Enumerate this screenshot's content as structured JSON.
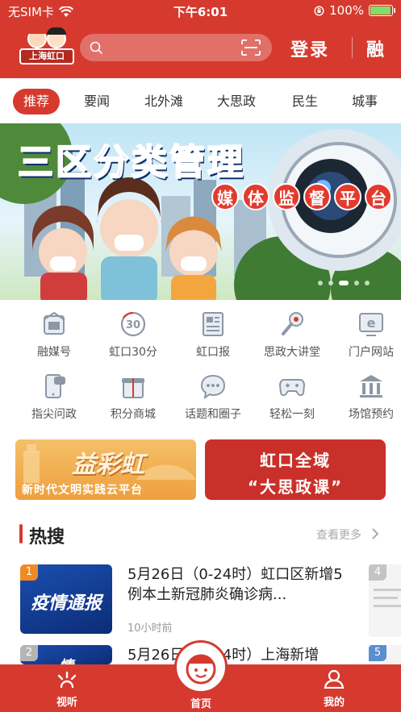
{
  "status_bar": {
    "carrier": "无SIM卡",
    "time": "下午6:01",
    "battery": "100%",
    "battery_level": 1.0
  },
  "header": {
    "logo_text": "上海虹口",
    "search_placeholder": "",
    "login_label": "登录",
    "right_label": "融"
  },
  "tabs": [
    "推荐",
    "要闻",
    "北外滩",
    "大思政",
    "民生",
    "城事"
  ],
  "active_tab": 0,
  "banner": {
    "title": "三区分类管理",
    "subtitle_chars": [
      "媒",
      "体",
      "监",
      "督",
      "平",
      "台"
    ],
    "page_count": 5,
    "active_page": 3
  },
  "grid": [
    {
      "label": "融媒号",
      "icon": "newspaper-stack-icon"
    },
    {
      "label": "虹口30分",
      "icon": "clock-30-icon"
    },
    {
      "label": "虹口报",
      "icon": "newspaper-icon"
    },
    {
      "label": "思政大讲堂",
      "icon": "microphone-icon"
    },
    {
      "label": "门户网站",
      "icon": "browser-icon"
    },
    {
      "label": "指尖问政",
      "icon": "phone-chat-icon"
    },
    {
      "label": "积分商城",
      "icon": "gift-icon"
    },
    {
      "label": "话题和圈子",
      "icon": "chat-bubble-icon"
    },
    {
      "label": "轻松一刻",
      "icon": "gamepad-icon"
    },
    {
      "label": "场馆预约",
      "icon": "museum-icon"
    }
  ],
  "promos": {
    "left_big": "益彩虹",
    "left_small": "新时代文明实践云平台",
    "right_line1": "虹口全域",
    "right_line2": "“大思政课”"
  },
  "hot": {
    "title": "热搜",
    "more_label": "查看更多",
    "items": [
      {
        "rank": "1",
        "thumb_text": "疫情通报",
        "title": "5月26日（0-24时）虹口区新增5例本土新冠肺炎确诊病...",
        "time": "10小时前"
      },
      {
        "rank": "2",
        "thumb_text": "情",
        "title": "5月26日（0-24时）上海新增"
      }
    ],
    "side_ranks": [
      "4",
      "5"
    ]
  },
  "bottom_nav": {
    "left": "视听",
    "center": "首页",
    "right": "我的"
  },
  "colors": {
    "brand_red": "#d63a2f",
    "rank_orange": "#f08a24",
    "rank_grey": "#b5b5b5"
  }
}
